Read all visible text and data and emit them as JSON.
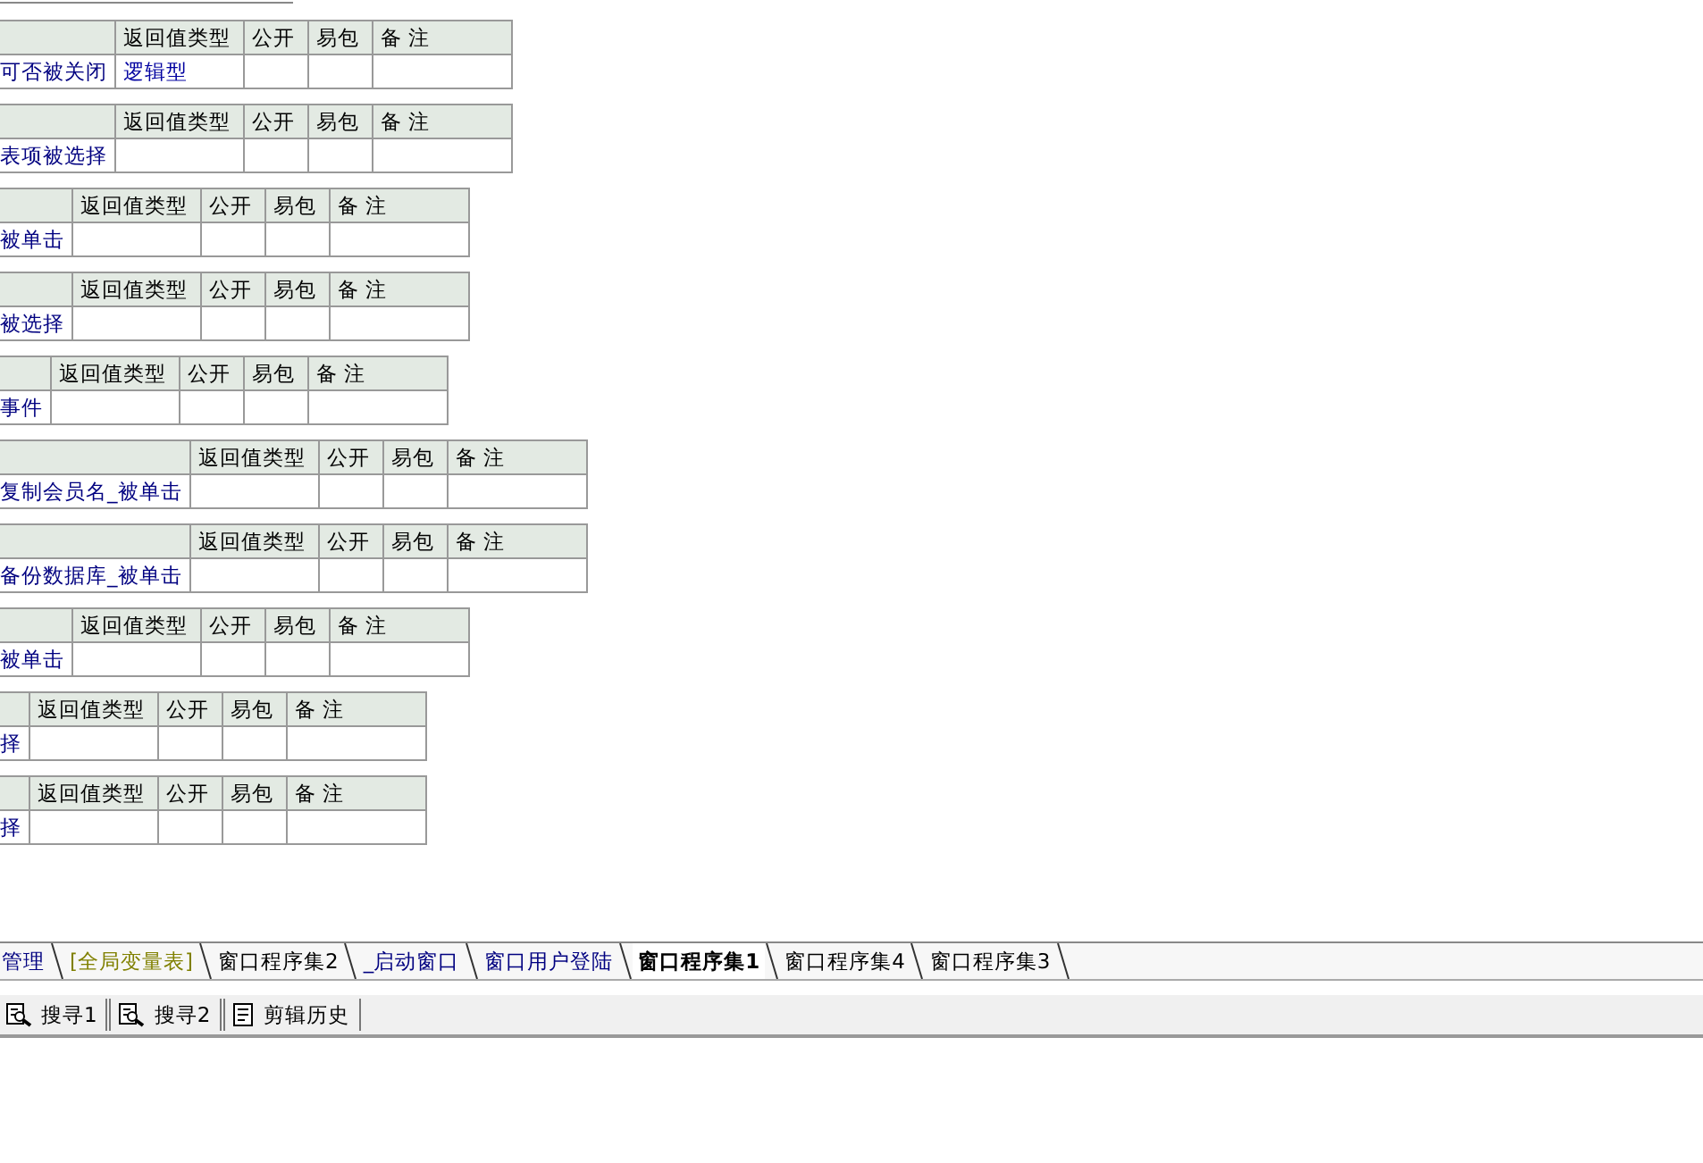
{
  "tables": [
    {
      "name": "可否被关闭",
      "columns": [
        "返回值类型",
        "公开",
        "易包",
        "备 注"
      ],
      "return_type": "逻辑型"
    },
    {
      "name": "表项被选择",
      "columns": [
        "返回值类型",
        "公开",
        "易包",
        "备 注"
      ]
    },
    {
      "name": "被单击",
      "columns": [
        "返回值类型",
        "公开",
        "易包",
        "备 注"
      ]
    },
    {
      "name": "被选择",
      "columns": [
        "返回值类型",
        "公开",
        "易包",
        "备 注"
      ]
    },
    {
      "name": "事件",
      "columns": [
        "返回值类型",
        "公开",
        "易包",
        "备 注"
      ]
    },
    {
      "name": "复制会员名_被单击",
      "columns": [
        "返回值类型",
        "公开",
        "易包",
        "备 注"
      ]
    },
    {
      "name": "备份数据库_被单击",
      "columns": [
        "返回值类型",
        "公开",
        "易包",
        "备 注"
      ]
    },
    {
      "name": "被单击",
      "columns": [
        "返回值类型",
        "公开",
        "易包",
        "备 注"
      ]
    },
    {
      "name": "择",
      "columns": [
        "返回值类型",
        "公开",
        "易包",
        "备 注"
      ]
    },
    {
      "name": "择",
      "columns": [
        "返回值类型",
        "公开",
        "易包",
        "备 注"
      ]
    }
  ],
  "tabs": [
    {
      "label": "管理",
      "selected": false,
      "color": "#000080"
    },
    {
      "label": "[全局变量表]",
      "selected": false,
      "color": "#808000"
    },
    {
      "label": "窗口程序集2",
      "selected": false,
      "color": "#000000"
    },
    {
      "label": "_启动窗口",
      "selected": false,
      "color": "#000080"
    },
    {
      "label": "窗口用户登陆",
      "selected": false,
      "color": "#000080"
    },
    {
      "label": "窗口程序集1",
      "selected": true,
      "color": "#000000"
    },
    {
      "label": "窗口程序集4",
      "selected": false,
      "color": "#000000"
    },
    {
      "label": "窗口程序集3",
      "selected": false,
      "color": "#000000"
    }
  ],
  "toolbar": [
    {
      "label": "搜寻1",
      "kind": "search"
    },
    {
      "label": "搜寻2",
      "kind": "search"
    },
    {
      "label": "剪辑历史",
      "kind": "history"
    }
  ]
}
